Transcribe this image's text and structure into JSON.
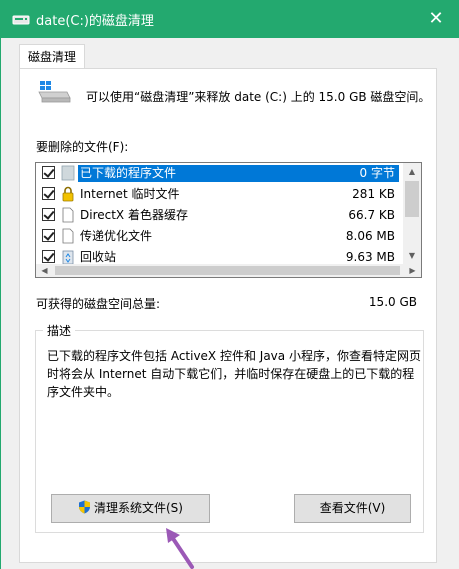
{
  "window": {
    "title": "date(C:)的磁盘清理",
    "close_glyph": "✕",
    "accent_color": "#23a96f"
  },
  "tabs": [
    {
      "label": "磁盘清理",
      "active": true
    }
  ],
  "intro": "可以使用“磁盘清理”来释放 date (C:) 上的 15.0 GB 磁盘空间。",
  "files_label": "要删除的文件(F):",
  "files": [
    {
      "name": "已下载的程序文件",
      "size": "0 字节",
      "checked": true,
      "selected": true,
      "icon": "folder-icon"
    },
    {
      "name": "Internet 临时文件",
      "size": "281 KB",
      "checked": true,
      "selected": false,
      "icon": "lock-icon"
    },
    {
      "name": "DirectX 着色器缓存",
      "size": "66.7 KB",
      "checked": true,
      "selected": false,
      "icon": "file-icon"
    },
    {
      "name": "传递优化文件",
      "size": "8.06 MB",
      "checked": true,
      "selected": false,
      "icon": "file-icon"
    },
    {
      "name": "回收站",
      "size": "9.63 MB",
      "checked": true,
      "selected": false,
      "icon": "recycle-bin-icon"
    }
  ],
  "space": {
    "label": "可获得的磁盘空间总量:",
    "value": "15.0 GB"
  },
  "description": {
    "title": "描述",
    "text": "已下载的程序文件包括 ActiveX 控件和 Java 小程序，你查看特定网页时将会从 Internet 自动下载它们，并临时保存在硬盘上的已下载的程序文件夹中。"
  },
  "buttons": {
    "cleanup_system": "清理系统文件(S)",
    "view_files": "查看文件(V)"
  },
  "annotation_color": "#9b59b6"
}
